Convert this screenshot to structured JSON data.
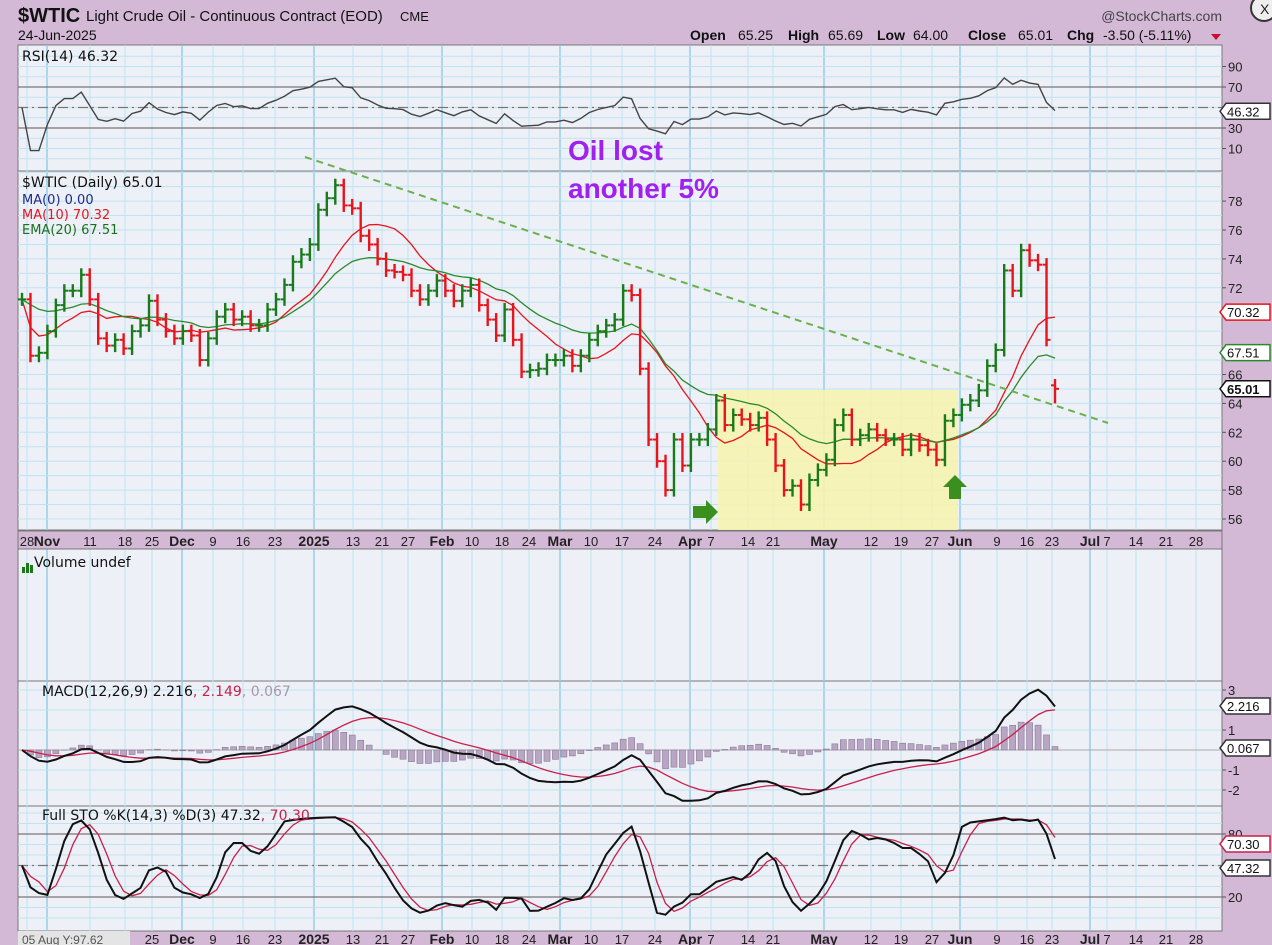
{
  "header": {
    "symbol": "$WTIC",
    "name": "Light Crude Oil - Continuous Contract (EOD)",
    "exchange": "CME",
    "date": "24-Jun-2025",
    "watermark": "@StockCharts.com",
    "open_label": "Open",
    "open": "65.25",
    "high_label": "High",
    "high": "65.69",
    "low_label": "Low",
    "low": "64.00",
    "close_label": "Close",
    "close": "65.01",
    "chg_label": "Chg",
    "chg": "-3.50 (-5.11%)",
    "close_button": "X"
  },
  "rsi_panel": {
    "legend": "RSI(14) 46.32",
    "tag": "46.32",
    "ticks": [
      "90",
      "70",
      "30",
      "10"
    ]
  },
  "price_panel": {
    "legend_main": "$WTIC (Daily) 65.01",
    "legend_ma0": "MA(0) 0.00",
    "legend_ma10": "MA(10) 70.32",
    "legend_ema20": "EMA(20) 67.51",
    "tag_ma10": "70.32",
    "tag_ema20": "67.51",
    "tag_close": "65.01",
    "annotation_line1": "Oil lost",
    "annotation_line2": "another 5%",
    "ticks": [
      "78",
      "76",
      "74",
      "72",
      "70",
      "68",
      "66",
      "64",
      "62",
      "60",
      "58",
      "56"
    ]
  },
  "volume_panel": {
    "legend": "Volume undef"
  },
  "macd_panel": {
    "legend_a": "MACD(12,26,9) 2.216",
    "legend_b": ", 2.149",
    "legend_c": ", 0.067",
    "tag_macd": "2.216",
    "tag_hist": "0.067",
    "ticks": [
      "3",
      "1",
      "-1",
      "-2"
    ]
  },
  "sto_panel": {
    "legend_a": "Full STO %K(14,3) %D(3) 47.32",
    "legend_b": ", 70.30",
    "tag_d": "70.30",
    "tag_k": "47.32",
    "ticks": [
      "80",
      "20"
    ]
  },
  "cursor_readout": "05 Aug Y:97.62",
  "x_axis_labels": [
    "28",
    "Nov",
    "11",
    "18",
    "25",
    "Dec",
    "9",
    "16",
    "23",
    "2025",
    "13",
    "21",
    "27",
    "Feb",
    "10",
    "18",
    "24",
    "Mar",
    "10",
    "17",
    "24",
    "Apr",
    "7",
    "14",
    "21",
    "May",
    "12",
    "19",
    "27",
    "Jun",
    "9",
    "16",
    "23",
    "Jul",
    "7",
    "14",
    "21",
    "28"
  ],
  "x_axis_bold": [
    "Nov",
    "Dec",
    "2025",
    "Feb",
    "Mar",
    "Apr",
    "May",
    "Jun",
    "Jul"
  ],
  "colors": {
    "up": "#1a7a1a",
    "down": "#e8141c",
    "ma10": "#e8141c",
    "ema20": "#2a8a2a",
    "signal": "#c8204a",
    "annotation": "#a020f0",
    "highlight": "#f5f3b0",
    "trendline": "#6ab04c"
  },
  "chart_data": {
    "type": "ohlc",
    "title": "$WTIC Light Crude Oil - Continuous Contract (EOD)",
    "x_range": [
      "28 Oct 2024",
      "24 Jun 2025"
    ],
    "ylim": [
      55,
      80
    ],
    "closes": [
      71.2,
      67.3,
      67.5,
      69.0,
      70.8,
      71.8,
      71.8,
      72.9,
      71.2,
      68.5,
      68.0,
      68.4,
      67.8,
      69.0,
      69.4,
      71.1,
      69.8,
      69.0,
      68.5,
      69.0,
      68.7,
      67.0,
      68.5,
      70.0,
      70.5,
      69.8,
      70.0,
      69.4,
      69.4,
      70.5,
      71.2,
      72.2,
      73.8,
      74.3,
      75.0,
      77.4,
      78.2,
      79.1,
      77.7,
      77.5,
      75.6,
      75.0,
      74.0,
      73.2,
      73.1,
      72.9,
      71.8,
      71.2,
      71.8,
      72.5,
      71.8,
      71.1,
      71.8,
      72.2,
      70.8,
      69.8,
      68.7,
      70.5,
      68.4,
      66.2,
      66.3,
      66.4,
      67.0,
      67.0,
      67.3,
      66.6,
      67.3,
      68.4,
      69.0,
      69.4,
      69.8,
      71.8,
      71.5,
      66.4,
      61.5,
      60.0,
      58.0,
      61.5,
      59.7,
      61.5,
      61.5,
      62.2,
      64.2,
      62.5,
      63.2,
      62.9,
      62.5,
      63.0,
      61.5,
      59.7,
      58.0,
      58.3,
      57.0,
      58.7,
      59.4,
      60.1,
      62.5,
      63.2,
      61.5,
      61.8,
      62.2,
      61.8,
      61.5,
      61.5,
      60.8,
      61.5,
      61.1,
      60.8,
      60.1,
      62.8,
      63.2,
      63.9,
      64.2,
      64.9,
      66.6,
      67.7,
      73.2,
      71.8,
      74.6,
      73.9,
      73.6,
      68.4,
      65.01
    ],
    "last_bar": {
      "open": 65.25,
      "high": 65.69,
      "low": 64.0,
      "close": 65.01
    },
    "overlays": [
      {
        "name": "MA(10)",
        "last": 70.32
      },
      {
        "name": "EMA(20)",
        "last": 67.51
      }
    ],
    "indicators": {
      "rsi": {
        "period": 14,
        "last": 46.32,
        "ylim": [
          0,
          100
        ],
        "levels": [
          70,
          30
        ]
      },
      "macd": {
        "fast": 12,
        "slow": 26,
        "signal": 9,
        "last_macd": 2.216,
        "last_signal": 2.149,
        "last_hist": 0.067
      },
      "sto": {
        "k": 14,
        "k_smooth": 3,
        "d": 3,
        "last_k": 47.32,
        "last_d": 70.3,
        "levels": [
          80,
          20
        ]
      }
    },
    "annotations": [
      "Oil lost another 5%",
      "downtrend line",
      "consolidation box Apr–May",
      "right arrow",
      "up arrow"
    ]
  }
}
